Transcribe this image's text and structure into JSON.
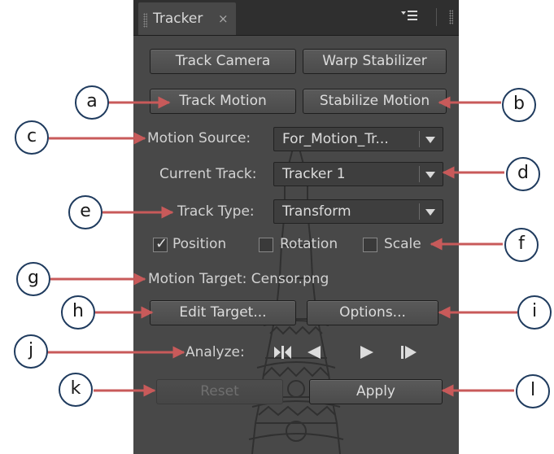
{
  "panel": {
    "tab_title": "Tracker",
    "close_glyph": "×",
    "track_camera": "Track Camera",
    "warp_stabilizer": "Warp Stabilizer",
    "track_motion": "Track Motion",
    "stabilize_motion": "Stabilize Motion",
    "motion_source_label": "Motion Source:",
    "motion_source_value": "For_Motion_Tr...",
    "current_track_label": "Current Track:",
    "current_track_value": "Tracker 1",
    "track_type_label": "Track Type:",
    "track_type_value": "Transform",
    "position_label": "Position",
    "position_checked": true,
    "rotation_label": "Rotation",
    "rotation_checked": false,
    "scale_label": "Scale",
    "scale_checked": false,
    "motion_target_text": "Motion Target: Censor.png",
    "edit_target": "Edit Target...",
    "options": "Options...",
    "analyze_label": "Analyze:",
    "reset": "Reset",
    "apply": "Apply"
  },
  "icons": {
    "transport": [
      "step-back-icon",
      "play-backward-icon",
      "play-forward-icon",
      "step-forward-icon"
    ],
    "panel_menu": "panel-menu-icon"
  },
  "callouts": [
    "a",
    "b",
    "c",
    "d",
    "e",
    "f",
    "g",
    "h",
    "i",
    "j",
    "k",
    "l"
  ],
  "colors": {
    "panel_bg": "#484848",
    "callout_border": "#1f3b5e",
    "arrow": "#c85a5a"
  }
}
